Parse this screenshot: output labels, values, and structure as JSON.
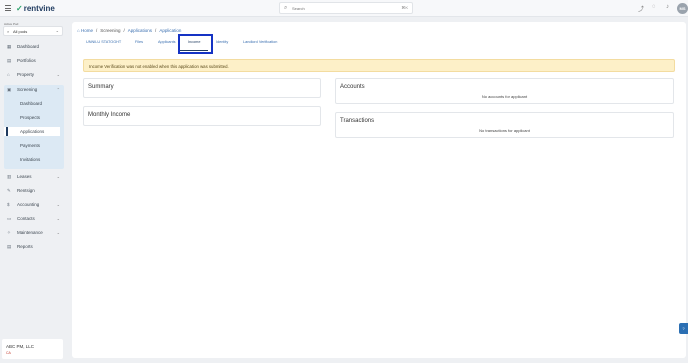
{
  "header": {
    "brand": "rentvine",
    "search_placeholder": "Search",
    "search_shortcut": "⌘K",
    "avatar_initials": "MS"
  },
  "sidebar": {
    "pod_label": "Active Pod",
    "pod_value": "All pods",
    "items": [
      {
        "label": "Dashboard",
        "icon": "dashboard-icon"
      },
      {
        "label": "Portfolios",
        "icon": "portfolio-icon"
      },
      {
        "label": "Property",
        "icon": "property-icon"
      },
      {
        "label": "Screening",
        "icon": "screening-icon"
      },
      {
        "label": "Leases",
        "icon": "leases-icon"
      },
      {
        "label": "Rentsign",
        "icon": "rentsign-icon"
      },
      {
        "label": "Accounting",
        "icon": "accounting-icon"
      },
      {
        "label": "Contacts",
        "icon": "contacts-icon"
      },
      {
        "label": "Maintenance",
        "icon": "maintenance-icon"
      },
      {
        "label": "Reports",
        "icon": "reports-icon"
      }
    ],
    "screening_sub": [
      {
        "label": "Dashboard"
      },
      {
        "label": "Prospects"
      },
      {
        "label": "Applications"
      },
      {
        "label": "Payments"
      },
      {
        "label": "Invitations"
      }
    ],
    "company_name": "ABC PM, LLC",
    "company_code": "CA"
  },
  "breadcrumb": {
    "home": "Home",
    "screening": "Screening",
    "applications": "Applications",
    "application": "Application"
  },
  "tabs": [
    {
      "label": "UNNILU STATOGHT"
    },
    {
      "label": "Files"
    },
    {
      "label": "Applicants"
    },
    {
      "label": "Income"
    },
    {
      "label": "Identity"
    },
    {
      "label": "Landlord Verification"
    }
  ],
  "alert_text": "Income Verification was not enabled when this application was submitted.",
  "cards": {
    "summary": {
      "title": "Summary"
    },
    "monthly_income": {
      "title": "Monthly Income"
    },
    "accounts": {
      "title": "Accounts",
      "empty": "No accounts for applicant"
    },
    "transactions": {
      "title": "Transactions",
      "empty": "No transactions for applicant"
    }
  },
  "colors": {
    "accent": "#1e3a5f",
    "link": "#3a6fb0",
    "highlight_box": "#1533c4",
    "alert_bg": "#fdf0c8",
    "nav_active_bg": "#dce9f4"
  }
}
